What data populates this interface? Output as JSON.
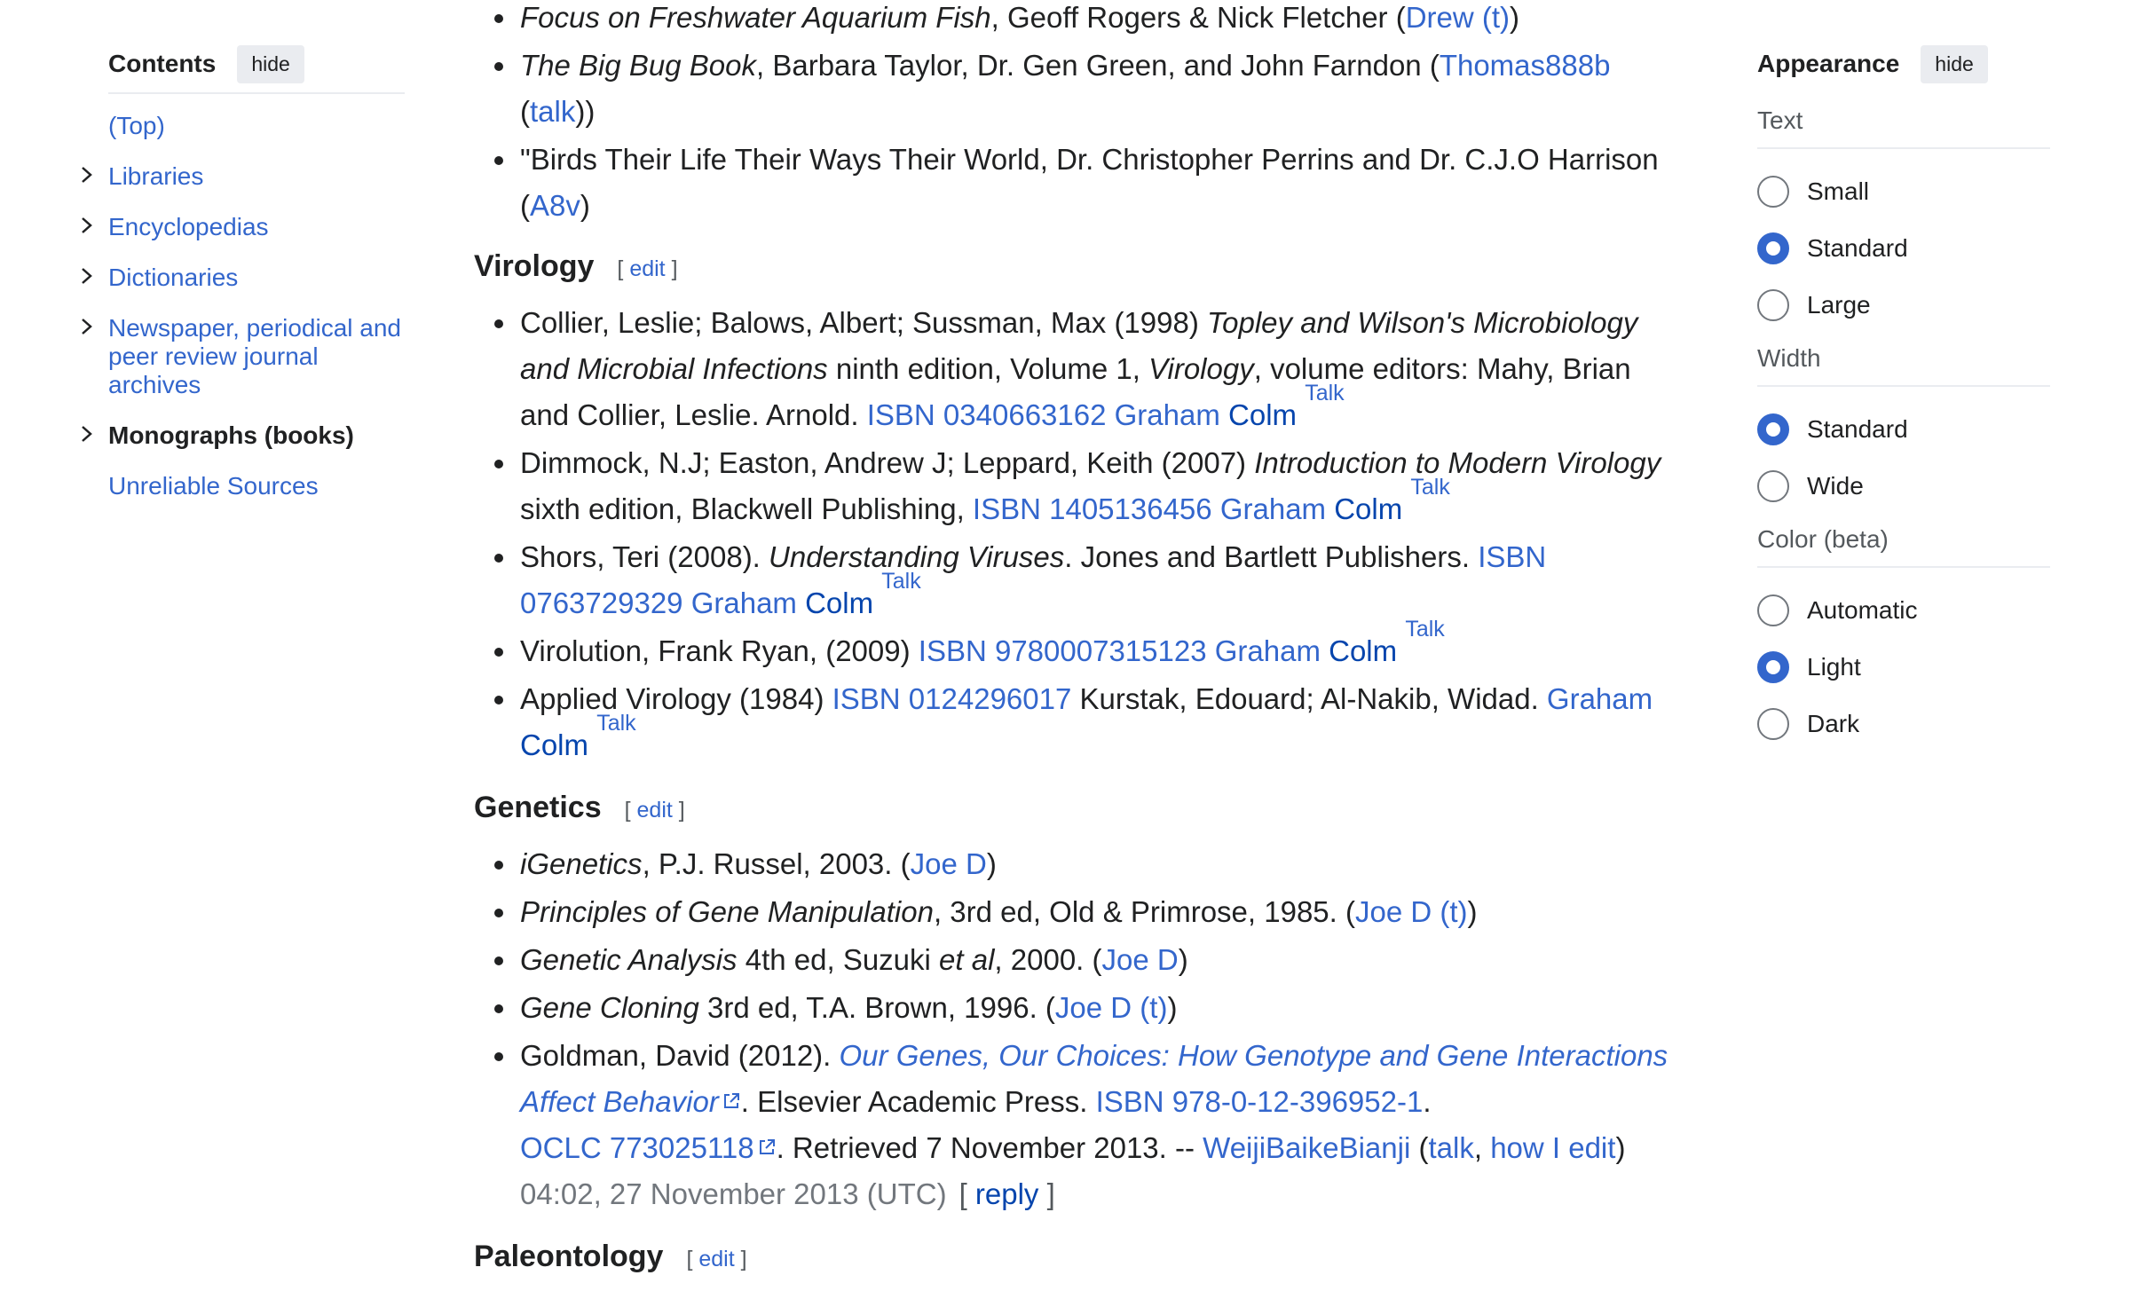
{
  "toc": {
    "title": "Contents",
    "hide_label": "hide",
    "items": [
      {
        "label": "(Top)"
      },
      {
        "label": "Libraries"
      },
      {
        "label": "Encyclopedias"
      },
      {
        "label": "Dictionaries"
      },
      {
        "label": "Newspaper, periodical and peer review journal archives"
      },
      {
        "label": "Monographs (books)"
      },
      {
        "label": "Unreliable Sources"
      }
    ]
  },
  "appearance": {
    "title": "Appearance",
    "hide_label": "hide",
    "text_label": "Text",
    "text_options": [
      "Small",
      "Standard",
      "Large"
    ],
    "text_selected": "Standard",
    "width_label": "Width",
    "width_options": [
      "Standard",
      "Wide"
    ],
    "width_selected": "Standard",
    "color_label": "Color (beta)",
    "color_options": [
      "Automatic",
      "Light",
      "Dark"
    ],
    "color_selected": "Light",
    "accent_color": "#3366cc"
  },
  "content": {
    "edit_label": "edit",
    "talk_label": "Talk",
    "top_items": {
      "i1_title": "Focus on Freshwater Aquarium Fish",
      "i1_rest": ", Geoff Rogers & Nick Fletcher (",
      "i1_user": "Drew (t)",
      "i1_close": ")",
      "i2_title": "The Big Bug Book",
      "i2_rest": ", Barbara Taylor, Dr. Gen Green, and John Farndon (",
      "i2_user": "Thomas888b",
      "i2_open": " (",
      "i2_talk": "talk",
      "i2_close": "))",
      "i3_text": "\"Birds Their Life Their Ways Their World, Dr. Christopher Perrins and Dr. C.J.O Harrison (",
      "i3_user": "A8v",
      "i3_close": ")"
    },
    "virology": {
      "heading": "Virology",
      "v1_a": "Collier, Leslie; Balows, Albert; Sussman, Max (1998) ",
      "v1_title": "Topley and Wilson's Microbiology and Microbial Infections",
      "v1_b": " ninth edition, Volume 1, ",
      "v1_vol": "Virology",
      "v1_c": ", volume editors: Mahy, Brian and Collier, Leslie. Arnold. ",
      "v1_isbn": "ISBN 0340663162",
      "v2_a": "Dimmock, N.J; Easton, Andrew J; Leppard, Keith (2007) ",
      "v2_title": "Introduction to Modern Virology",
      "v2_b": " sixth edition, Blackwell Publishing, ",
      "v2_isbn": "ISBN 1405136456",
      "v3_a": "Shors, Teri (2008). ",
      "v3_title": "Understanding Viruses",
      "v3_b": ". Jones and Bartlett Publishers. ",
      "v3_isbn": "ISBN 0763729329",
      "v4_a": "Virolution, Frank Ryan, (2009) ",
      "v4_isbn": "ISBN 9780007315123",
      "v5_a": "Applied Virology (1984) ",
      "v5_isbn": "ISBN 0124296017",
      "v5_b": " Kurstak, Edouard; Al-Nakib, Widad. ",
      "sig_graham": "Graham",
      "sig_colm": "Colm"
    },
    "genetics": {
      "heading": "Genetics",
      "g1_title": "iGenetics",
      "g1_rest": ", P.J. Russel, 2003. (",
      "g1_user": "Joe D",
      "g1_close": ")",
      "g2_title": "Principles of Gene Manipulation",
      "g2_rest": ", 3rd ed, Old & Primrose, 1985. (",
      "g2_user": "Joe D (t)",
      "g2_close": ")",
      "g3_title": "Genetic Analysis",
      "g3_a": " 4th ed, Suzuki ",
      "g3_etal": "et al",
      "g3_b": ", 2000. (",
      "g3_user": "Joe D",
      "g3_close": ")",
      "g4_title": "Gene Cloning",
      "g4_rest": " 3rd ed, T.A. Brown, 1996. (",
      "g4_user": "Joe D (t)",
      "g4_close": ")",
      "g5_a": "Goldman, David (2012). ",
      "g5_title": "Our Genes, Our Choices: How Genotype and Gene Interactions Affect Behavior",
      "g5_b": ". Elsevier Academic Press. ",
      "g5_isbn": "ISBN 978-0-12-396952-1",
      "g5_c": ". ",
      "g5_oclc": "OCLC 773025118",
      "g5_d": ". Retrieved 7 November 2013. -- ",
      "g5_user": "WeijiBaikeBianji",
      "g5_open": " (",
      "g5_talk": "talk",
      "g5_comma": ", ",
      "g5_howiedit": "how I edit",
      "g5_close": ")",
      "g5_timestamp": "04:02, 27 November 2013 (UTC)",
      "g5_reply_open": "[ ",
      "g5_reply": "reply",
      "g5_reply_close": " ]"
    },
    "paleontology": {
      "heading": "Paleontology"
    }
  }
}
